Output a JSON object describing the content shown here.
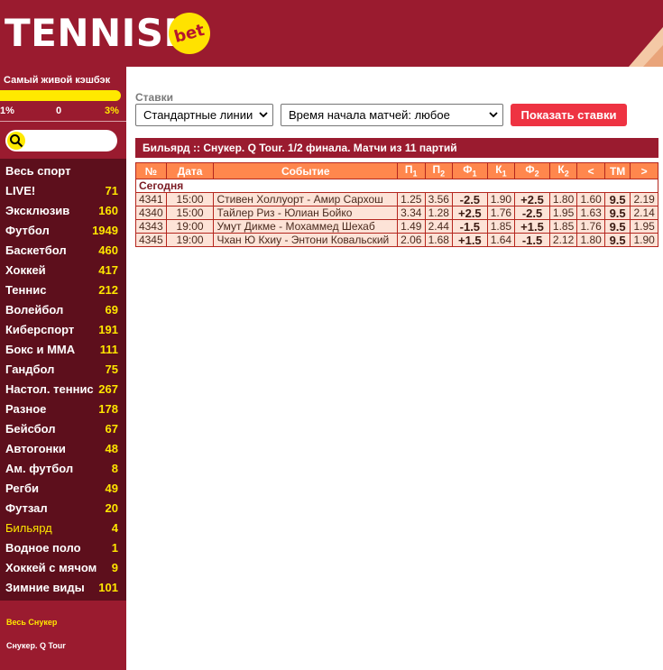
{
  "header": {
    "logo_text": "TENNISI",
    "logo_badge": "bet"
  },
  "sidebar": {
    "cashback_title": "Самый живой кэшбэк",
    "cashback_min": "1%",
    "cashback_mid": "0",
    "cashback_max": "3%",
    "search_placeholder": "",
    "items": [
      {
        "label": "Весь спорт",
        "count": ""
      },
      {
        "label": "LIVE!",
        "count": "71"
      },
      {
        "label": "Эксклюзив",
        "count": "160"
      },
      {
        "label": "Футбол",
        "count": "1949"
      },
      {
        "label": "Баскетбол",
        "count": "460"
      },
      {
        "label": "Хоккей",
        "count": "417"
      },
      {
        "label": "Теннис",
        "count": "212"
      },
      {
        "label": "Волейбол",
        "count": "69"
      },
      {
        "label": "Киберспорт",
        "count": "191"
      },
      {
        "label": "Бокс и ММА",
        "count": "111"
      },
      {
        "label": "Гандбол",
        "count": "75"
      },
      {
        "label": "Настол. теннис",
        "count": "267"
      },
      {
        "label": "Разное",
        "count": "178"
      },
      {
        "label": "Бейсбол",
        "count": "67"
      },
      {
        "label": "Автогонки",
        "count": "48"
      },
      {
        "label": "Ам. футбол",
        "count": "8"
      },
      {
        "label": "Регби",
        "count": "49"
      },
      {
        "label": "Футзал",
        "count": "20"
      },
      {
        "label": "Бильярд",
        "count": "4"
      },
      {
        "label": "Водное поло",
        "count": "1"
      },
      {
        "label": "Хоккей с мячом",
        "count": "9"
      },
      {
        "label": "Зимние виды",
        "count": "101"
      }
    ],
    "sub_links": [
      "Весь Снукер",
      "Снукер. Q Tour"
    ]
  },
  "main": {
    "stavki_label": "Ставки",
    "line_select": "Стандартные линии",
    "time_select": "Время начала матчей: любое",
    "show_button": "Показать ставки",
    "table_title": "Бильярд :: Снукер. Q Tour. 1/2 финала. Матчи из 11 партий",
    "columns": [
      "№",
      "Дата",
      "Событие",
      "П1",
      "П2",
      "Ф1",
      "К1",
      "Ф2",
      "К2",
      "<",
      "ТМ",
      ">"
    ],
    "group_label": "Сегодня",
    "rows": [
      {
        "num": "4341",
        "time": "15:00",
        "event": "Стивен Холлуорт - Амир Сархош",
        "p1": "1.25",
        "p2": "3.56",
        "f1": "-2.5",
        "k1": "1.90",
        "f2": "+2.5",
        "k2": "1.80",
        "lt": "1.60",
        "tm": "9.5",
        "gt": "2.19"
      },
      {
        "num": "4340",
        "time": "15:00",
        "event": "Тайлер Риз - Юлиан Бойко",
        "p1": "3.34",
        "p2": "1.28",
        "f1": "+2.5",
        "k1": "1.76",
        "f2": "-2.5",
        "k2": "1.95",
        "lt": "1.63",
        "tm": "9.5",
        "gt": "2.14"
      },
      {
        "num": "4343",
        "time": "19:00",
        "event": "Умут Дикме - Мохаммед Шехаб",
        "p1": "1.49",
        "p2": "2.44",
        "f1": "-1.5",
        "k1": "1.85",
        "f2": "+1.5",
        "k2": "1.85",
        "lt": "1.76",
        "tm": "9.5",
        "gt": "1.95"
      },
      {
        "num": "4345",
        "time": "19:00",
        "event": "Чхан Ю Кхиу - Энтони Ковальский",
        "p1": "2.06",
        "p2": "1.68",
        "f1": "+1.5",
        "k1": "1.64",
        "f2": "-1.5",
        "k2": "2.12",
        "lt": "1.80",
        "tm": "9.5",
        "gt": "1.90"
      }
    ]
  },
  "colors": {
    "brand": "#9a1b2f",
    "sidebar_dark": "#5d0f1c",
    "accent_yellow": "#ffe900",
    "header_cells": "#ff874d",
    "button_red": "#ee3342"
  }
}
